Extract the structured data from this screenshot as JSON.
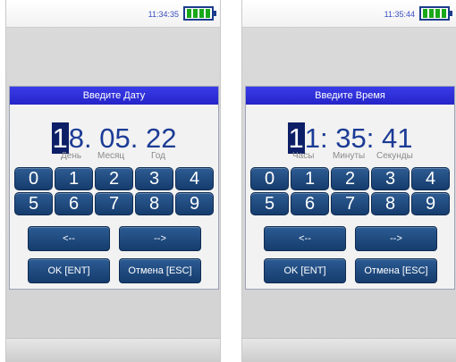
{
  "date_screen": {
    "status_time": "11:34:35",
    "title": "Введите Дату",
    "display": {
      "cursor": "1",
      "rest": "8. 05. 22"
    },
    "labels": {
      "first": "День",
      "second": "Месяц",
      "third": "Год"
    },
    "keys": [
      "0",
      "1",
      "2",
      "3",
      "4",
      "5",
      "6",
      "7",
      "8",
      "9"
    ],
    "back_label": "<--",
    "forward_label": "-->",
    "ok_label": "OK [ENT]",
    "cancel_label": "Отмена [ESC]"
  },
  "time_screen": {
    "status_time": "11:35:44",
    "title": "Введите Время",
    "display": {
      "cursor": "1",
      "rest": "1: 35: 41"
    },
    "labels": {
      "first": "Часы",
      "second": "Минуты",
      "third": "Секунды"
    },
    "keys": [
      "0",
      "1",
      "2",
      "3",
      "4",
      "5",
      "6",
      "7",
      "8",
      "9"
    ],
    "back_label": "<--",
    "forward_label": "-->",
    "ok_label": "OK [ENT]",
    "cancel_label": "Отмена [ESC]"
  },
  "colors": {
    "title_bar": "#2a2ad6",
    "key": "#1f4a80",
    "digits": "#1b3b95",
    "battery_fill": "#18a818"
  }
}
